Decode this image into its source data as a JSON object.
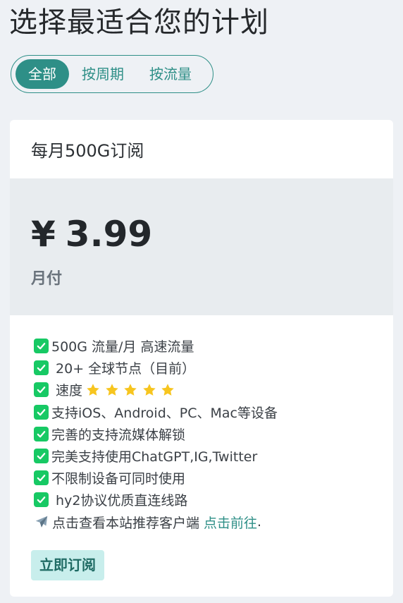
{
  "page": {
    "title": "选择最适合您的计划"
  },
  "filters": [
    {
      "label": "全部",
      "active": true
    },
    {
      "label": "按周期",
      "active": false
    },
    {
      "label": "按流量",
      "active": false
    }
  ],
  "plan": {
    "name": "每月500G订阅",
    "currency": "¥",
    "price": "3.99",
    "period": "月付",
    "features": [
      {
        "icon": "check-icon",
        "text": "500G 流量/月 高速流量"
      },
      {
        "icon": "check-icon",
        "text": " 20+ 全球节点（目前）"
      },
      {
        "icon": "check-icon",
        "text": " 速度",
        "stars": 5
      },
      {
        "icon": "check-icon",
        "text": "支持iOS、Android、PC、Mac等设备"
      },
      {
        "icon": "check-icon",
        "text": "完善的支持流媒体解锁"
      },
      {
        "icon": "check-icon",
        "text": "完美支持使用ChatGPT,IG,Twitter"
      },
      {
        "icon": "check-icon",
        "text": "不限制设备可同时使用"
      },
      {
        "icon": "check-icon",
        "text": " hy2协议优质直连线路"
      }
    ],
    "client_note": {
      "icon": "airplane-icon",
      "text": "点击查看本站推荐客户端",
      "link": "点击前往",
      "suffix": "."
    },
    "subscribe_label": "立即订阅"
  },
  "colors": {
    "accent": "#2e8f87",
    "check": "#17c964",
    "star": "#f7c51f",
    "button_bg": "#c8eeec"
  }
}
